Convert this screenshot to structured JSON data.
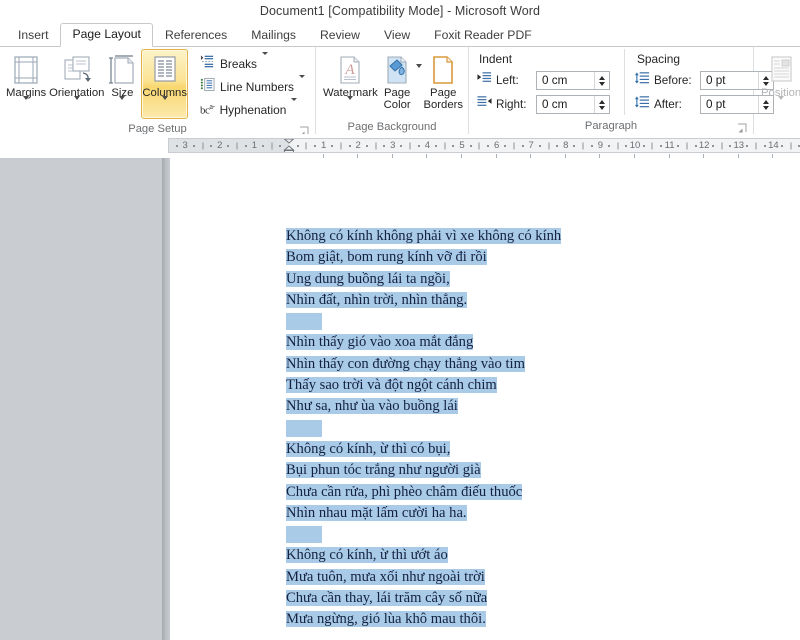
{
  "window": {
    "title": "Document1 [Compatibility Mode]  -  Microsoft Word"
  },
  "tabs": [
    {
      "label": "Insert",
      "active": false
    },
    {
      "label": "Page Layout",
      "active": true
    },
    {
      "label": "References",
      "active": false
    },
    {
      "label": "Mailings",
      "active": false
    },
    {
      "label": "Review",
      "active": false
    },
    {
      "label": "View",
      "active": false
    },
    {
      "label": "Foxit Reader PDF",
      "active": false
    }
  ],
  "ribbon": {
    "groups": [
      {
        "name": "page-setup",
        "label": "Page Setup",
        "big_buttons": [
          {
            "label": "Margins",
            "icon": "margins-icon",
            "has_caret": true
          },
          {
            "label": "Orientation",
            "icon": "orientation-icon",
            "has_caret": true
          },
          {
            "label": "Size",
            "icon": "size-icon",
            "has_caret": true
          },
          {
            "label": "Columns",
            "icon": "columns-icon",
            "has_caret": true,
            "highlighted": true
          }
        ],
        "small_buttons": [
          {
            "label": "Breaks",
            "icon": "breaks-icon",
            "has_caret": true
          },
          {
            "label": "Line Numbers",
            "icon": "line-numbers-icon",
            "has_caret": true
          },
          {
            "label": "Hyphenation",
            "icon": "hyphenation-icon",
            "has_caret": true
          }
        ]
      },
      {
        "name": "page-background",
        "label": "Page Background",
        "big_buttons": [
          {
            "label": "Watermark",
            "icon": "watermark-icon",
            "has_caret": true
          },
          {
            "label": "Page Color",
            "icon": "page-color-icon",
            "has_caret": true
          },
          {
            "label": "Page Borders",
            "icon": "page-borders-icon",
            "has_caret": false
          }
        ]
      },
      {
        "name": "paragraph",
        "label": "Paragraph",
        "indent": {
          "header": "Indent",
          "rows": [
            {
              "label": "Left:",
              "value": "0 cm",
              "icon": "indent-left-icon"
            },
            {
              "label": "Right:",
              "value": "0 cm",
              "icon": "indent-right-icon"
            }
          ]
        },
        "spacing": {
          "header": "Spacing",
          "rows": [
            {
              "label": "Before:",
              "value": "0 pt",
              "icon": "spacing-before-icon"
            },
            {
              "label": "After:",
              "value": "0 pt",
              "icon": "spacing-after-icon"
            }
          ]
        }
      },
      {
        "name": "arrange",
        "label": "",
        "big_buttons": [
          {
            "label": "Position",
            "icon": "position-icon",
            "has_caret": true,
            "dimmed": true
          }
        ]
      }
    ]
  },
  "ruler": {
    "left_labels": [
      "3",
      "2",
      "1"
    ],
    "right_labels": [
      "1",
      "2",
      "3",
      "4",
      "5",
      "6",
      "7",
      "8",
      "9",
      "10",
      "11",
      "12",
      "13",
      "14"
    ],
    "unit": "cm"
  },
  "document": {
    "stanzas": [
      {
        "lines": [
          "Không có kính không phải vì xe không có kính",
          "Bom giật, bom rung kính vỡ đi rồi",
          "Ung dung buồng lái ta ngồi,",
          "Nhìn đất, nhìn trời, nhìn thẳng."
        ]
      },
      {
        "lines": [
          "Nhìn thấy gió vào xoa mắt đắng",
          "Nhìn thấy con đường chạy thẳng vào tim",
          "Thấy sao trời và đột ngột cánh chim",
          "Như sa, như ùa vào buồng lái"
        ]
      },
      {
        "lines": [
          "Không có kính, ừ thì có bụi,",
          "Bụi phun tóc trắng như người già",
          "Chưa cần rửa, phì phèo châm điếu thuốc",
          "Nhìn nhau mặt lấm cười ha ha."
        ]
      },
      {
        "lines": [
          "Không có kính, ừ thì ướt áo",
          "Mưa tuôn, mưa xối như ngoài trời",
          "Chưa cần thay, lái trăm cây số nữa",
          "Mưa ngừng, gió lùa khô mau thôi."
        ]
      }
    ],
    "selection_color": "#a9cbe8",
    "text_color": "#13213f",
    "all_selected": true
  },
  "colors": {
    "workspace_gray": "#c9cdd1",
    "page_white": "#ffffff",
    "selection": "#a9cbe8",
    "highlight_gold": "#f8d76e",
    "tab_border": "#c6c9cc"
  }
}
